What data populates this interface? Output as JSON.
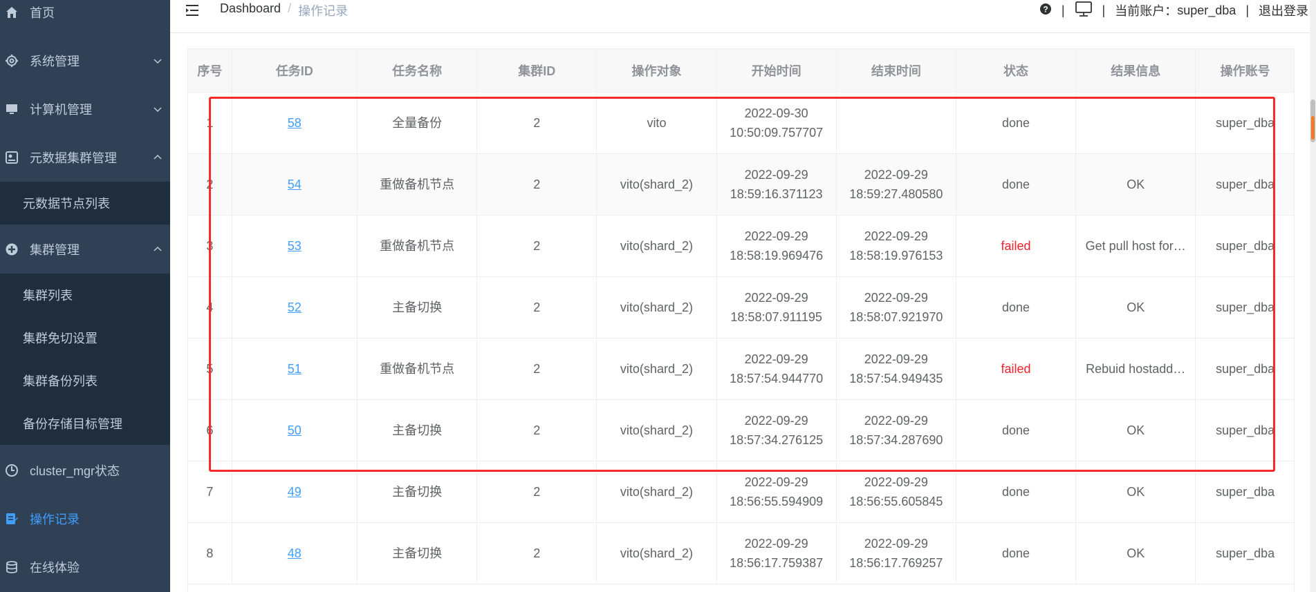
{
  "sidebar": {
    "items": [
      {
        "label": "首页",
        "icon": "home-icon"
      },
      {
        "label": "系统管理",
        "icon": "gear-icon"
      },
      {
        "label": "计算机管理",
        "icon": "monitor-icon"
      },
      {
        "label": "元数据集群管理",
        "icon": "metadata-icon"
      },
      {
        "label": "集群管理",
        "icon": "cluster-icon"
      },
      {
        "label": "cluster_mgr状态",
        "icon": "status-icon"
      },
      {
        "label": "操作记录",
        "icon": "record-icon"
      },
      {
        "label": "在线体验",
        "icon": "database-icon"
      }
    ],
    "metadata_sub": [
      "元数据节点列表"
    ],
    "cluster_sub": [
      "集群列表",
      "集群免切设置",
      "集群备份列表",
      "备份存储目标管理"
    ]
  },
  "header": {
    "breadcrumb_home": "Dashboard",
    "breadcrumb_sep": "/",
    "breadcrumb_current": "操作记录",
    "divider": "|",
    "account_label": "当前账户：",
    "account_name": "super_dba",
    "logout": "退出登录"
  },
  "table": {
    "columns": [
      "序号",
      "任务ID",
      "任务名称",
      "集群ID",
      "操作对象",
      "开始时间",
      "结束时间",
      "状态",
      "结果信息",
      "操作账号"
    ],
    "rows": [
      {
        "no": "1",
        "id": "58",
        "name": "全量备份",
        "cluster": "2",
        "target": "vito",
        "start": "2022-09-30 10:50:09.757707",
        "end": "",
        "status": "done",
        "result": "",
        "account": "super_dba"
      },
      {
        "no": "2",
        "id": "54",
        "name": "重做备机节点",
        "cluster": "2",
        "target": "vito(shard_2)",
        "start": "2022-09-29 18:59:16.371123",
        "end": "2022-09-29 18:59:27.480580",
        "status": "done",
        "result": "OK",
        "account": "super_dba"
      },
      {
        "no": "3",
        "id": "53",
        "name": "重做备机节点",
        "cluster": "2",
        "target": "vito(shard_2)",
        "start": "2022-09-29 18:58:19.969476",
        "end": "2022-09-29 18:58:19.976153",
        "status": "failed",
        "result": "Get pull host for…",
        "account": "super_dba"
      },
      {
        "no": "4",
        "id": "52",
        "name": "主备切换",
        "cluster": "2",
        "target": "vito(shard_2)",
        "start": "2022-09-29 18:58:07.911195",
        "end": "2022-09-29 18:58:07.921970",
        "status": "done",
        "result": "OK",
        "account": "super_dba"
      },
      {
        "no": "5",
        "id": "51",
        "name": "重做备机节点",
        "cluster": "2",
        "target": "vito(shard_2)",
        "start": "2022-09-29 18:57:54.944770",
        "end": "2022-09-29 18:57:54.949435",
        "status": "failed",
        "result": "Rebuid hostadd…",
        "account": "super_dba"
      },
      {
        "no": "6",
        "id": "50",
        "name": "主备切换",
        "cluster": "2",
        "target": "vito(shard_2)",
        "start": "2022-09-29 18:57:34.276125",
        "end": "2022-09-29 18:57:34.287690",
        "status": "done",
        "result": "OK",
        "account": "super_dba"
      },
      {
        "no": "7",
        "id": "49",
        "name": "主备切换",
        "cluster": "2",
        "target": "vito(shard_2)",
        "start": "2022-09-29 18:56:55.594909",
        "end": "2022-09-29 18:56:55.605845",
        "status": "done",
        "result": "OK",
        "account": "super_dba"
      },
      {
        "no": "8",
        "id": "48",
        "name": "主备切换",
        "cluster": "2",
        "target": "vito(shard_2)",
        "start": "2022-09-29 18:56:17.759387",
        "end": "2022-09-29 18:56:17.769257",
        "status": "done",
        "result": "OK",
        "account": "super_dba"
      }
    ]
  },
  "colors": {
    "sidebar_bg": "#304156",
    "submenu_bg": "#1f2d3d",
    "active": "#409eff",
    "failed": "#f5222d",
    "highlight": "#f52a2a"
  }
}
